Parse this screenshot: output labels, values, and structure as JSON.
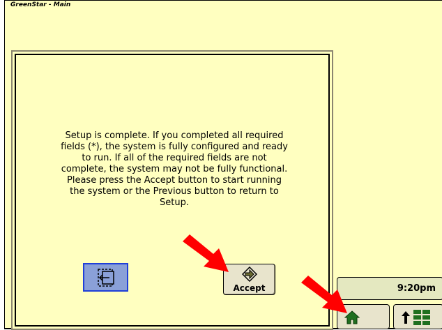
{
  "window": {
    "title": "GreenStar - Main"
  },
  "dialog": {
    "message": "Setup is complete.  If you completed all required\nfields (*), the system is fully configured and ready\nto run.  If all of the required fields are not\ncomplete, the system may not be fully functional.\nPlease press the Accept button to start running\nthe system or the Previous button to return to\nSetup.",
    "previous_icon": "previous-page-icon",
    "accept_icon": "accept-arrow-icon",
    "accept_label": "Accept"
  },
  "status": {
    "time": "9:20pm"
  },
  "nav": {
    "home_icon": "home-icon",
    "menu_icon": "menu-up-icon"
  },
  "colors": {
    "screen_bg": "#ffffc0",
    "previous_button_fill": "#8aa0d8",
    "previous_button_border": "#1f3fd8",
    "home_icon": "#1f6f1f",
    "annotation_arrow": "#ff0000"
  }
}
